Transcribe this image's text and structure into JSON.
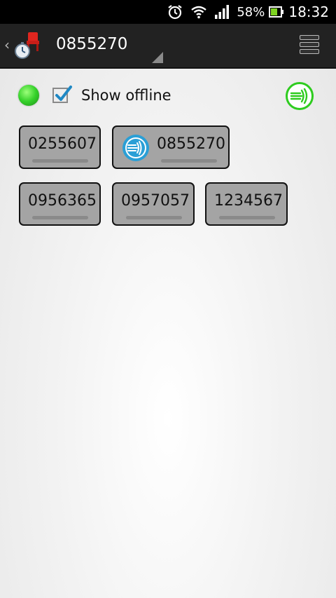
{
  "status_bar": {
    "battery_percent": "58%",
    "time": "18:32",
    "icons": [
      "alarm-icon",
      "wifi-icon",
      "signal-icon",
      "battery-icon"
    ]
  },
  "action_bar": {
    "title": "0855270",
    "icons": [
      "back-caret-icon",
      "app-logo-icon",
      "spinner-indicator-icon",
      "menu-icon"
    ]
  },
  "controls": {
    "presence_color": "#35d12a",
    "show_offline_checked": true,
    "show_offline_label": "Show offline",
    "ptt_icon_color": "#2ecc1f"
  },
  "contacts": [
    {
      "id": "0255607",
      "has_avatar": false
    },
    {
      "id": "0855270",
      "has_avatar": true
    },
    {
      "id": "0956365",
      "has_avatar": false
    },
    {
      "id": "0957057",
      "has_avatar": false
    },
    {
      "id": "1234567",
      "has_avatar": false
    }
  ],
  "colors": {
    "status_bar_bg": "#000000",
    "action_bar_bg": "#222222",
    "tile_bg": "#a4a4a4",
    "avatar_blue": "#2a9fd6"
  }
}
